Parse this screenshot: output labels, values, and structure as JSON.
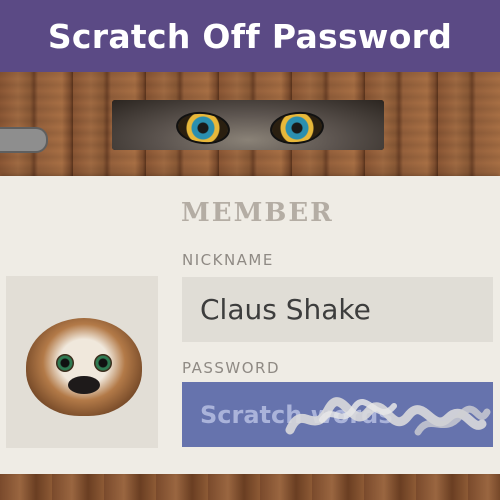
{
  "header": {
    "title": "Scratch Off Password"
  },
  "card": {
    "title": "MEMBER",
    "nickname_label": "NICKNAME",
    "nickname_value": "Claus Shake",
    "password_label": "PASSWORD",
    "password_placeholder": "Scratch words"
  },
  "colors": {
    "header_bg": "#5b4a85",
    "password_field": "#6673ad",
    "card_bg": "#efece5"
  },
  "icons": [
    "hinge-icon",
    "wolf-eyes-illustration",
    "sloth-avatar-icon"
  ]
}
